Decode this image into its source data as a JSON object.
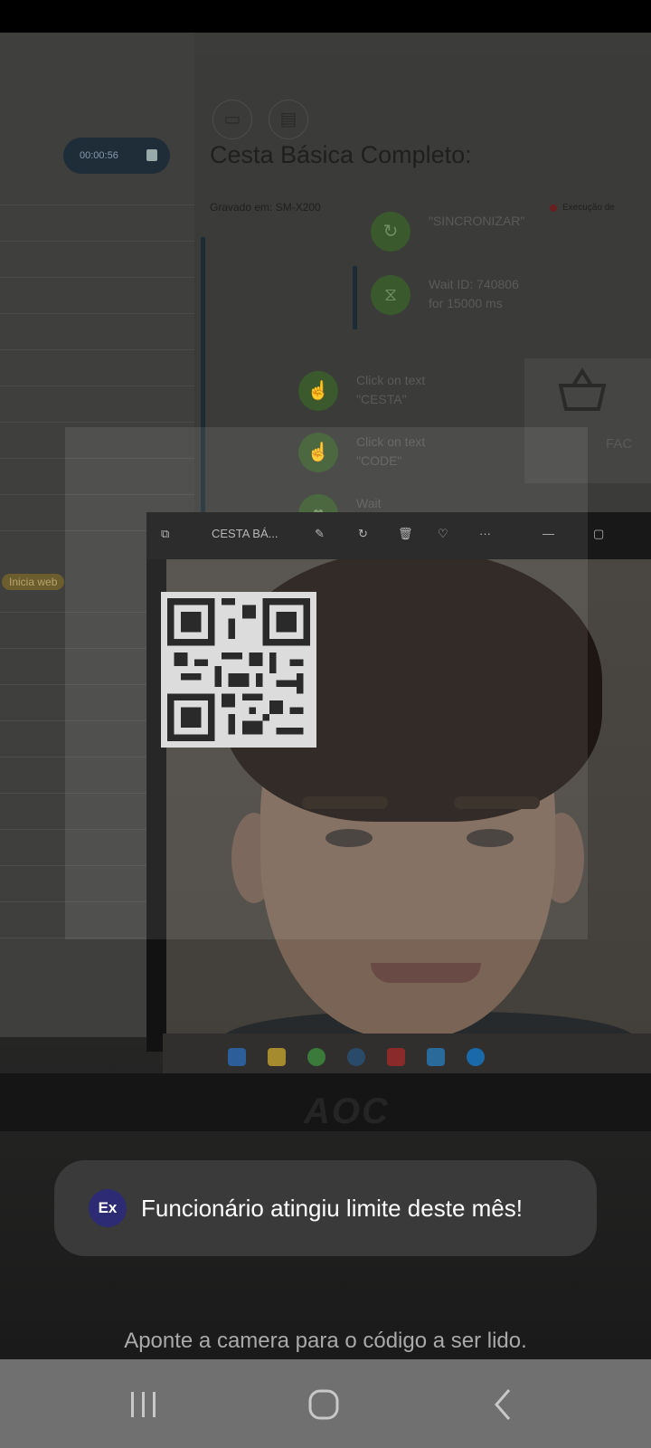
{
  "background_app": {
    "timer": "00:00:56",
    "title": "Cesta Básica Completo:",
    "recorded_on": "Gravado em: SM-X200",
    "execution_label": "Execução de",
    "steps": [
      {
        "line1": "\"SINCRONIZAR\"",
        "line2": ""
      },
      {
        "line1": "Wait ID: 740806",
        "line2": "for 15000 ms"
      },
      {
        "line1": "Click on text",
        "line2": "\"CESTA\""
      },
      {
        "line1": "Click on text",
        "line2": "\"CODE\""
      },
      {
        "line1": "Wait",
        "line2": ""
      }
    ],
    "tag": "Inicia web",
    "card_label": "FAC"
  },
  "photo_viewer": {
    "title": "CESTA BÁ...",
    "more": "···"
  },
  "monitor_brand": "AOC",
  "toast": {
    "icon_text": "Ex",
    "message": "Funcionário atingiu limite deste mês!"
  },
  "hint": "Aponte a camera para o código a ser lido.",
  "nav": {
    "recents_icon": "recents-icon",
    "home_icon": "home-icon",
    "back_icon": "back-icon"
  }
}
